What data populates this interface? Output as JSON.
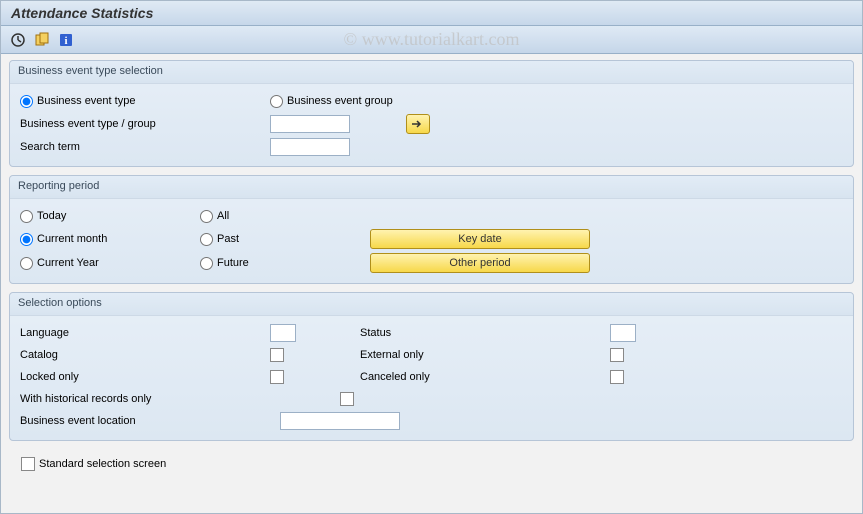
{
  "title": "Attendance Statistics",
  "watermark": "© www.tutorialkart.com",
  "group1": {
    "title": "Business event type selection",
    "radio_type": "Business event type",
    "radio_group": "Business event group",
    "type_group_label": "Business event type / group",
    "type_group_value": "",
    "search_label": "Search term",
    "search_value": ""
  },
  "group2": {
    "title": "Reporting period",
    "today": "Today",
    "all": "All",
    "current_month": "Current month",
    "past": "Past",
    "current_year": "Current Year",
    "future": "Future",
    "key_date_btn": "Key date",
    "other_period_btn": "Other period"
  },
  "group3": {
    "title": "Selection options",
    "language": "Language",
    "status": "Status",
    "catalog": "Catalog",
    "external_only": "External only",
    "locked_only": "Locked only",
    "canceled_only": "Canceled only",
    "historical": "With historical records only",
    "location": "Business event location",
    "location_value": ""
  },
  "footer": {
    "std_sel": "Standard selection screen"
  }
}
